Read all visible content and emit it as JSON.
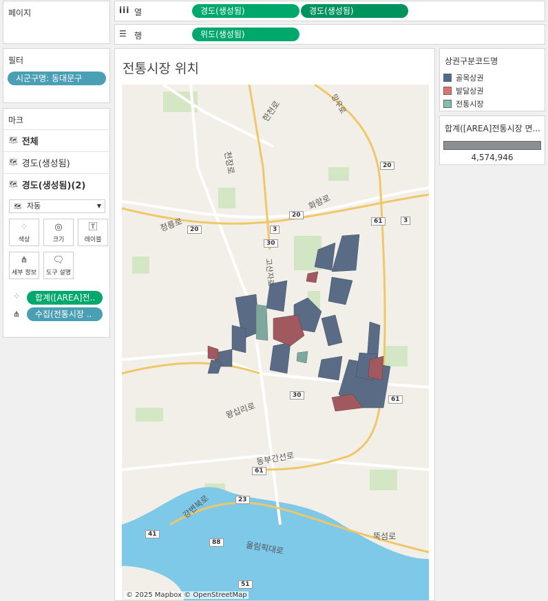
{
  "shelves": {
    "pages_label": "페이지",
    "columns_label": "열",
    "rows_label": "행",
    "columns": [
      "경도(생성됨)",
      "경도(생성됨)"
    ],
    "rows": [
      "위도(생성됨)"
    ]
  },
  "filters": {
    "title": "필터",
    "items": [
      "시군구명: 동대문구"
    ]
  },
  "marks": {
    "title": "마크",
    "layers": [
      "전체",
      "경도(생성됨)",
      "경도(생성됨)(2)"
    ],
    "mark_type": "자동",
    "buttons": [
      "색상",
      "크기",
      "레이블",
      "세부 정보",
      "도구 설명"
    ],
    "pills": [
      "합계([AREA]전..",
      "수집(전통시장 .."
    ]
  },
  "view": {
    "title": "전통시장 위치",
    "attribution": "© 2025 Mapbox © OpenStreetMap",
    "map_labels": [
      "한천로",
      "천장로",
      "화랑로",
      "정릉로",
      "왕십리로",
      "동부간선로",
      "강변북로",
      "올림픽대로",
      "뚝섬로",
      "고산자로",
      "망우로"
    ],
    "road_shields": [
      "20",
      "20",
      "20",
      "3",
      "3",
      "30",
      "30",
      "61",
      "61",
      "61",
      "23",
      "88",
      "41",
      "51"
    ]
  },
  "legend": {
    "title": "상권구분코드명",
    "items": [
      {
        "label": "골목상권",
        "color": "#4e6a8c"
      },
      {
        "label": "발달상권",
        "color": "#e0736f"
      },
      {
        "label": "전통시장",
        "color": "#7fbfb0"
      }
    ]
  },
  "size_legend": {
    "title": "합계([AREA]전통시장 면...",
    "value": "4,574,946"
  },
  "colors": {
    "green_pill": "#00a86b",
    "teal_pill": "#4a9fb5",
    "market_fill": "#a05a5f",
    "alley_fill": "#5a6b85"
  }
}
